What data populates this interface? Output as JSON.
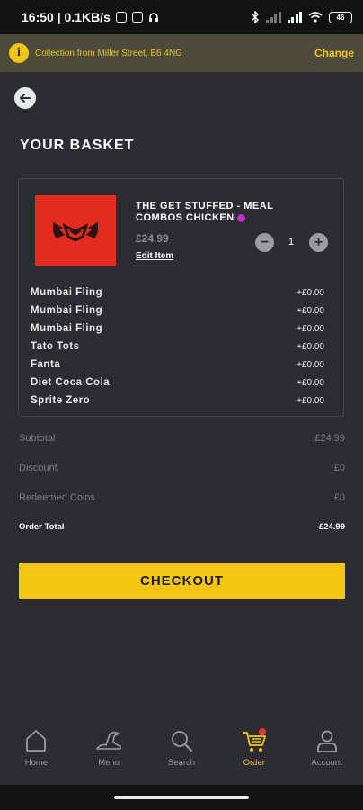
{
  "status_bar": {
    "time": "16:50 | 0.1KB/s",
    "battery": "46"
  },
  "banner": {
    "info_icon_glyph": "i",
    "text": "Collection from Miller Street, B6 4NG",
    "change_label": "Change"
  },
  "page": {
    "title": "YOUR BASKET"
  },
  "basket_item": {
    "name": "THE GET STUFFED - MEAL COMBOS CHICKEN",
    "price": "£24.99",
    "edit_label": "Edit Item",
    "quantity": "1",
    "minus_glyph": "−",
    "plus_glyph": "+",
    "options": [
      {
        "name": "Mumbai Fling",
        "price": "+£0.00"
      },
      {
        "name": "Mumbai Fling",
        "price": "+£0.00"
      },
      {
        "name": "Mumbai Fling",
        "price": "+£0.00"
      },
      {
        "name": "Tato Tots",
        "price": "+£0.00"
      },
      {
        "name": "Fanta",
        "price": "+£0.00"
      },
      {
        "name": "Diet Coca Cola",
        "price": "+£0.00"
      },
      {
        "name": "Sprite Zero",
        "price": "+£0.00"
      }
    ]
  },
  "summary": {
    "subtotal_label": "Subtotal",
    "subtotal_value": "£24.99",
    "discount_label": "Discount",
    "discount_value": "£0",
    "coins_label": "Redeemed Coins",
    "coins_value": "£0",
    "total_label": "Order Total",
    "total_value": "£24.99"
  },
  "checkout_label": "CHECKOUT",
  "nav": {
    "items": [
      {
        "label": "Home",
        "icon": "home-icon"
      },
      {
        "label": "Menu",
        "icon": "menu-icon"
      },
      {
        "label": "Search",
        "icon": "search-icon"
      },
      {
        "label": "Order",
        "icon": "cart-icon",
        "active": true
      },
      {
        "label": "Account",
        "icon": "account-icon"
      }
    ]
  },
  "colors": {
    "accent": "#f3c613",
    "background": "#2b2d30",
    "product_image": "#e32b20",
    "badge": "#e83a32"
  }
}
